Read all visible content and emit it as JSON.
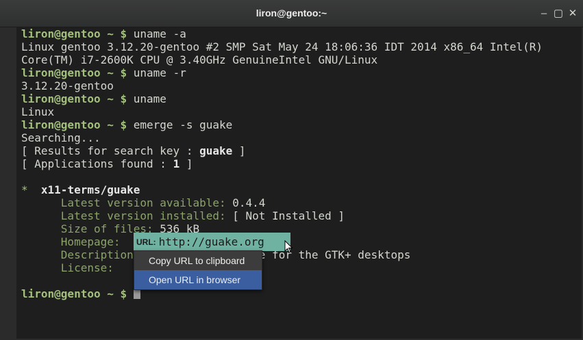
{
  "window": {
    "title": "liron@gentoo:~"
  },
  "controls": {
    "minimize": "‒",
    "maximize": "▢",
    "close": "✕"
  },
  "terminal": {
    "prompt": "liron@gentoo ~ $ ",
    "lines": {
      "cmd1": "uname -a",
      "out1a": "Linux gentoo 3.12.20-gentoo #2 SMP Sat May 24 18:06:36 IDT 2014 x86_64 Intel(R)",
      "out1b": "Core(TM) i7-2600K CPU @ 3.40GHz GenuineIntel GNU/Linux",
      "cmd2": "uname -r",
      "out2": "3.12.20-gentoo",
      "cmd3": "uname",
      "out3": "Linux",
      "cmd4": "emerge -s guake",
      "out4a": "Searching...",
      "results_pre": "[ Results for search key : ",
      "results_key": "guake",
      "results_post": " ]",
      "apps_pre": "[ Applications found : ",
      "apps_count": "1",
      "apps_post": " ]",
      "pkg_star": "*",
      "pkg_name": "x11-terms/guake",
      "latest_avail_label": "Latest version available:",
      "latest_avail_value": " 0.4.4",
      "latest_inst_label": "Latest version installed:",
      "latest_inst_value": " [ Not Installed ]",
      "size_label": "Size of files:",
      "size_value": " 536 kB",
      "homepage_label": "Homepage:",
      "description_label": "Description",
      "description_value": "minal made for the GTK+ desktops",
      "license_label": "License:"
    }
  },
  "url_popup": {
    "tag": "URL:",
    "url": "http://guake.org"
  },
  "context_menu": {
    "items": [
      "Copy URL to clipboard",
      "Open URL in browser"
    ],
    "active_index": 1
  }
}
